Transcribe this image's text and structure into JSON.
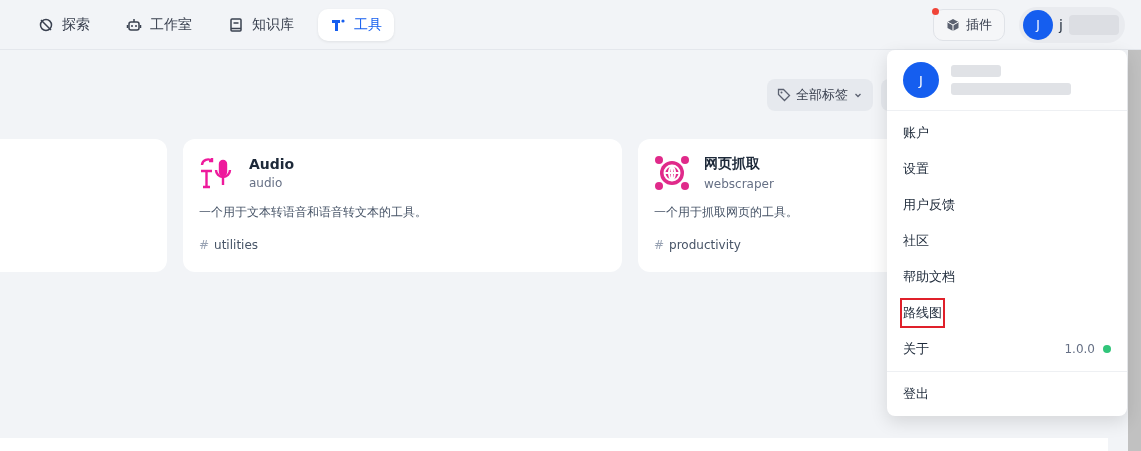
{
  "nav": {
    "tabs": [
      {
        "label": "探索",
        "selected": false
      },
      {
        "label": "工作室",
        "selected": false
      },
      {
        "label": "知识库",
        "selected": false
      },
      {
        "label": "工具",
        "selected": true
      }
    ],
    "plugins": {
      "label": "插件",
      "notification": true
    },
    "user": {
      "avatar": "J",
      "name": "j"
    }
  },
  "filter": {
    "label": "全部标签"
  },
  "cards": [
    {
      "kind": "blank"
    },
    {
      "kind": "tool",
      "title": "Audio",
      "subtitle": "audio",
      "description": "一个用于文本转语音和语音转文本的工具。",
      "tag_mark": "#",
      "tag": "utilities"
    },
    {
      "kind": "tool",
      "title": "网页抓取",
      "subtitle": "webscraper",
      "description": "一个用于抓取网页的工具。",
      "tag_mark": "#",
      "tag": "productivity"
    }
  ],
  "menu": {
    "avatar": "J",
    "groups": [
      [
        {
          "label": "账户",
          "highlighted": false
        },
        {
          "label": "设置",
          "highlighted": false
        },
        {
          "label": "用户反馈",
          "highlighted": false
        },
        {
          "label": "社区",
          "highlighted": false
        },
        {
          "label": "帮助文档",
          "highlighted": false
        },
        {
          "label": "路线图",
          "highlighted": true
        },
        {
          "label": "关于",
          "highlighted": false,
          "version": "1.0.0",
          "color": "#31c57a"
        }
      ],
      [
        {
          "label": "登出",
          "highlighted": false
        }
      ]
    ]
  }
}
